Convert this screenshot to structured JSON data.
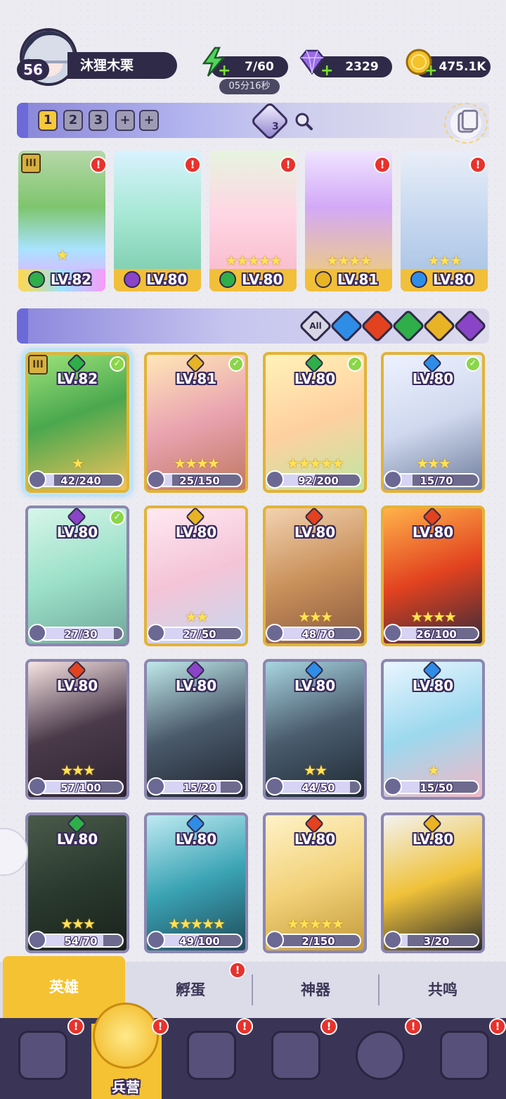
{
  "player": {
    "level": "56",
    "name": "沐狸木栗"
  },
  "resources": {
    "energy": "7/60",
    "energy_timer": "05分16秒",
    "gems": "2329",
    "gold": "475.1K"
  },
  "team": {
    "slots": [
      "1",
      "2",
      "3",
      "+",
      "+"
    ],
    "gem_count": "3"
  },
  "deployed": [
    {
      "level": "LV.82",
      "element": "nature",
      "stars": "★",
      "tier": "III"
    },
    {
      "level": "LV.80",
      "element": "dark",
      "stars": ""
    },
    {
      "level": "LV.80",
      "element": "nature",
      "stars": "★★★★★"
    },
    {
      "level": "LV.81",
      "element": "light",
      "stars": "★★★★"
    },
    {
      "level": "LV.80",
      "element": "water",
      "stars": "★★★"
    }
  ],
  "filters": {
    "all": "All",
    "elements": [
      "water",
      "fire",
      "nature",
      "light",
      "dark"
    ]
  },
  "heroes": [
    {
      "level": "LV.82",
      "element": "nature",
      "progress": "42/240",
      "fill": 0.175,
      "checked": true,
      "stars": "★",
      "tier": "III"
    },
    {
      "level": "LV.81",
      "element": "light",
      "progress": "25/150",
      "fill": 0.167,
      "checked": true,
      "stars": "★★★★"
    },
    {
      "level": "LV.80",
      "element": "nature",
      "progress": "92/200",
      "fill": 0.46,
      "checked": true,
      "stars": "★★★★★"
    },
    {
      "level": "LV.80",
      "element": "water",
      "progress": "15/70",
      "fill": 0.214,
      "checked": true,
      "stars": "★★★"
    },
    {
      "level": "LV.80",
      "element": "dark",
      "progress": "27/30",
      "fill": 0.9,
      "checked": true,
      "stars": ""
    },
    {
      "level": "LV.80",
      "element": "light",
      "progress": "27/50",
      "fill": 0.54,
      "checked": false,
      "stars": "★★"
    },
    {
      "level": "LV.80",
      "element": "fire",
      "progress": "48/70",
      "fill": 0.686,
      "checked": false,
      "stars": "★★★"
    },
    {
      "level": "LV.80",
      "element": "fire",
      "progress": "26/100",
      "fill": 0.26,
      "checked": false,
      "stars": "★★★★"
    },
    {
      "level": "LV.80",
      "element": "fire",
      "progress": "57/100",
      "fill": 0.57,
      "checked": false,
      "stars": "★★★"
    },
    {
      "level": "LV.80",
      "element": "dark",
      "progress": "15/20",
      "fill": 0.75,
      "checked": false,
      "stars": ""
    },
    {
      "level": "LV.80",
      "element": "water",
      "progress": "44/50",
      "fill": 0.88,
      "checked": false,
      "stars": "★★"
    },
    {
      "level": "LV.80",
      "element": "water",
      "progress": "15/50",
      "fill": 0.3,
      "checked": false,
      "stars": "★"
    },
    {
      "level": "LV.80",
      "element": "nature",
      "progress": "54/70",
      "fill": 0.771,
      "checked": false,
      "stars": "★★★"
    },
    {
      "level": "LV.80",
      "element": "water",
      "progress": "49/100",
      "fill": 0.49,
      "checked": false,
      "stars": "★★★★★"
    },
    {
      "level": "LV.80",
      "element": "fire",
      "progress": "2/150",
      "fill": 0.013,
      "checked": false,
      "stars": "★★★★★"
    },
    {
      "level": "LV.80",
      "element": "light",
      "progress": "3/20",
      "fill": 0.15,
      "checked": false,
      "stars": ""
    }
  ],
  "subtabs": [
    "英雄",
    "孵蛋",
    "神器",
    "共鸣"
  ],
  "nav": {
    "active_label": "兵营"
  },
  "colors": {
    "water": "#2f8de8",
    "fire": "#e2421f",
    "nature": "#2fae4a",
    "light": "#e9b326",
    "dark": "#8a44c8",
    "accent": "#f5c233",
    "panel": "#2f2a48"
  }
}
